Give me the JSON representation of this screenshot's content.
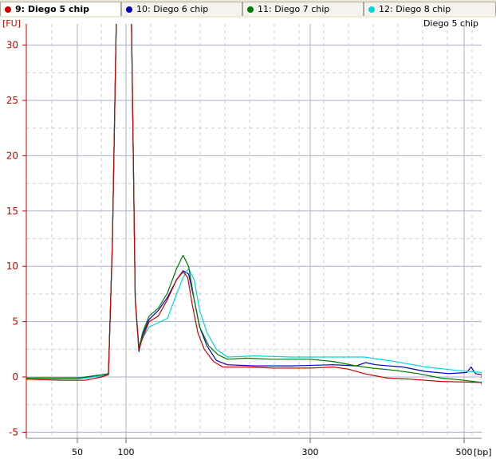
{
  "tabs": [
    {
      "label": "9: Diego 5 chip",
      "color": "#d00000",
      "active": true
    },
    {
      "label": "10: Diego 6 chip",
      "color": "#0000c0",
      "active": false
    },
    {
      "label": "11: Diego 7 chip",
      "color": "#007a00",
      "active": false
    },
    {
      "label": "12: Diego 8 chip",
      "color": "#00d8d8",
      "active": false
    }
  ],
  "chart_data": {
    "type": "line",
    "title": "Diego 5 chip",
    "ylabel": "[FU]",
    "xlabel": "[bp]",
    "ylim": [
      -5.5,
      32
    ],
    "y_ticks": [
      -5,
      0,
      5,
      10,
      15,
      20,
      25,
      30
    ],
    "x_ticks": [
      50,
      100,
      300,
      500
    ],
    "grid": true,
    "series": [
      {
        "name": "9: Diego 5 chip",
        "color": "#d00000",
        "points": [
          [
            33,
            -0.2
          ],
          [
            45,
            -0.3
          ],
          [
            58,
            -0.3
          ],
          [
            75,
            0.0
          ],
          [
            82,
            0.2
          ],
          [
            86,
            12
          ],
          [
            90,
            32
          ],
          [
            93,
            32
          ],
          [
            97,
            32
          ],
          [
            101,
            32
          ],
          [
            106,
            32
          ],
          [
            110,
            7
          ],
          [
            114,
            2.5
          ],
          [
            118,
            3.5
          ],
          [
            125,
            5.0
          ],
          [
            135,
            5.5
          ],
          [
            145,
            7.0
          ],
          [
            155,
            8.8
          ],
          [
            162,
            9.5
          ],
          [
            167,
            9.0
          ],
          [
            172,
            6.5
          ],
          [
            178,
            4.0
          ],
          [
            185,
            2.5
          ],
          [
            195,
            1.4
          ],
          [
            205,
            0.9
          ],
          [
            230,
            0.9
          ],
          [
            260,
            0.8
          ],
          [
            300,
            0.8
          ],
          [
            330,
            0.9
          ],
          [
            350,
            0.7
          ],
          [
            370,
            0.3
          ],
          [
            400,
            -0.1
          ],
          [
            430,
            -0.2
          ],
          [
            470,
            -0.4
          ],
          [
            520,
            -0.5
          ],
          [
            560,
            -0.6
          ],
          [
            604,
            -0.7
          ]
        ]
      },
      {
        "name": "10: Diego 6 chip",
        "color": "#0000c0",
        "points": [
          [
            33,
            -0.1
          ],
          [
            50,
            -0.1
          ],
          [
            75,
            0.1
          ],
          [
            82,
            0.3
          ],
          [
            86,
            12
          ],
          [
            90,
            32
          ],
          [
            93,
            32
          ],
          [
            97,
            32
          ],
          [
            101,
            32
          ],
          [
            106,
            32
          ],
          [
            110,
            7
          ],
          [
            114,
            2.3
          ],
          [
            118,
            3.8
          ],
          [
            125,
            5.2
          ],
          [
            135,
            6.0
          ],
          [
            145,
            7.2
          ],
          [
            155,
            8.8
          ],
          [
            162,
            9.6
          ],
          [
            168,
            9.3
          ],
          [
            174,
            7.0
          ],
          [
            180,
            4.5
          ],
          [
            188,
            2.8
          ],
          [
            198,
            1.5
          ],
          [
            210,
            1.1
          ],
          [
            240,
            1.0
          ],
          [
            280,
            1.0
          ],
          [
            330,
            1.1
          ],
          [
            360,
            1.0
          ],
          [
            372,
            1.3
          ],
          [
            385,
            1.1
          ],
          [
            420,
            0.9
          ],
          [
            450,
            0.5
          ],
          [
            480,
            0.3
          ],
          [
            503,
            0.4
          ],
          [
            508,
            0.9
          ],
          [
            513,
            0.3
          ],
          [
            530,
            0.2
          ],
          [
            560,
            0.1
          ],
          [
            590,
            0.1
          ],
          [
            604,
            -0.1
          ]
        ]
      },
      {
        "name": "11: Diego 7 chip",
        "color": "#007a00",
        "points": [
          [
            33,
            -0.1
          ],
          [
            50,
            -0.1
          ],
          [
            75,
            0.2
          ],
          [
            82,
            0.3
          ],
          [
            86,
            12
          ],
          [
            90,
            32
          ],
          [
            93,
            32
          ],
          [
            97,
            32
          ],
          [
            101,
            32
          ],
          [
            106,
            32
          ],
          [
            110,
            7
          ],
          [
            114,
            2.6
          ],
          [
            118,
            4.0
          ],
          [
            125,
            5.5
          ],
          [
            135,
            6.2
          ],
          [
            145,
            7.6
          ],
          [
            155,
            9.8
          ],
          [
            162,
            11.0
          ],
          [
            168,
            10.0
          ],
          [
            174,
            7.0
          ],
          [
            180,
            4.5
          ],
          [
            190,
            2.8
          ],
          [
            200,
            2.0
          ],
          [
            210,
            1.6
          ],
          [
            230,
            1.7
          ],
          [
            260,
            1.6
          ],
          [
            300,
            1.6
          ],
          [
            330,
            1.4
          ],
          [
            360,
            1.0
          ],
          [
            380,
            0.8
          ],
          [
            410,
            0.6
          ],
          [
            440,
            0.3
          ],
          [
            470,
            -0.1
          ],
          [
            500,
            -0.3
          ],
          [
            540,
            -0.5
          ],
          [
            575,
            -0.6
          ],
          [
            604,
            -0.6
          ]
        ]
      },
      {
        "name": "12: Diego 8 chip",
        "color": "#00d8d8",
        "points": [
          [
            33,
            -0.2
          ],
          [
            50,
            -0.2
          ],
          [
            75,
            0.1
          ],
          [
            82,
            0.2
          ],
          [
            86,
            12
          ],
          [
            90,
            32
          ],
          [
            93,
            32
          ],
          [
            97,
            32
          ],
          [
            101,
            32
          ],
          [
            106,
            32
          ],
          [
            110,
            7
          ],
          [
            114,
            2.7
          ],
          [
            118,
            3.5
          ],
          [
            125,
            4.5
          ],
          [
            135,
            4.9
          ],
          [
            145,
            5.3
          ],
          [
            155,
            7.5
          ],
          [
            162,
            9.0
          ],
          [
            168,
            9.8
          ],
          [
            174,
            8.8
          ],
          [
            180,
            6.0
          ],
          [
            188,
            4.0
          ],
          [
            198,
            2.5
          ],
          [
            210,
            1.8
          ],
          [
            240,
            1.9
          ],
          [
            280,
            1.8
          ],
          [
            330,
            1.8
          ],
          [
            370,
            1.8
          ],
          [
            410,
            1.4
          ],
          [
            450,
            0.9
          ],
          [
            490,
            0.6
          ],
          [
            530,
            0.4
          ],
          [
            570,
            0.3
          ],
          [
            604,
            0.0
          ]
        ]
      }
    ]
  }
}
